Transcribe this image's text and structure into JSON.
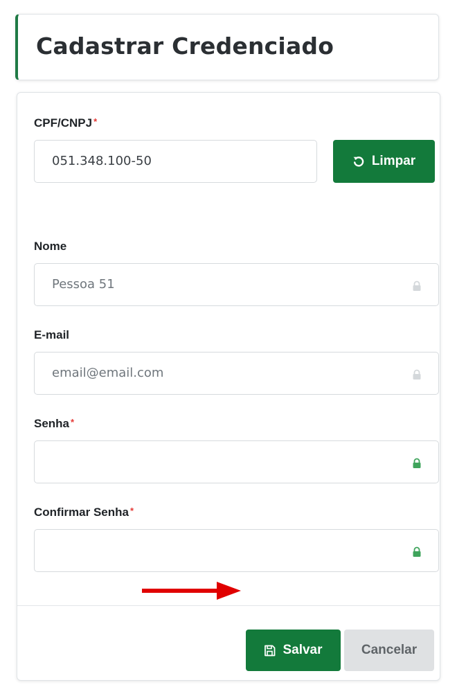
{
  "header": {
    "title": "Cadastrar Credenciado"
  },
  "form": {
    "cpf": {
      "label": "CPF/CNPJ",
      "required_mark": "*",
      "value": "051.348.100-50"
    },
    "limpar_label": "Limpar",
    "nome": {
      "label": "Nome",
      "value": "Pessoa 51"
    },
    "email": {
      "label": "E-mail",
      "value": "email@email.com"
    },
    "senha": {
      "label": "Senha",
      "required_mark": "*",
      "value": ""
    },
    "confirmar_senha": {
      "label": "Confirmar Senha",
      "required_mark": "*",
      "value": ""
    }
  },
  "footer": {
    "salvar_label": "Salvar",
    "cancelar_label": "Cancelar"
  },
  "icons": {
    "limpar": "undo-icon",
    "salvar": "floppy-disk-icon",
    "lock": "lock-icon",
    "annotation": "red-arrow"
  },
  "colors": {
    "primary": "#137a3b",
    "accent_border": "#1f7a45",
    "required": "#e53935",
    "lock_active": "#3fa45c",
    "lock_disabled": "#d4d8db",
    "annotation_arrow": "#e00000"
  }
}
